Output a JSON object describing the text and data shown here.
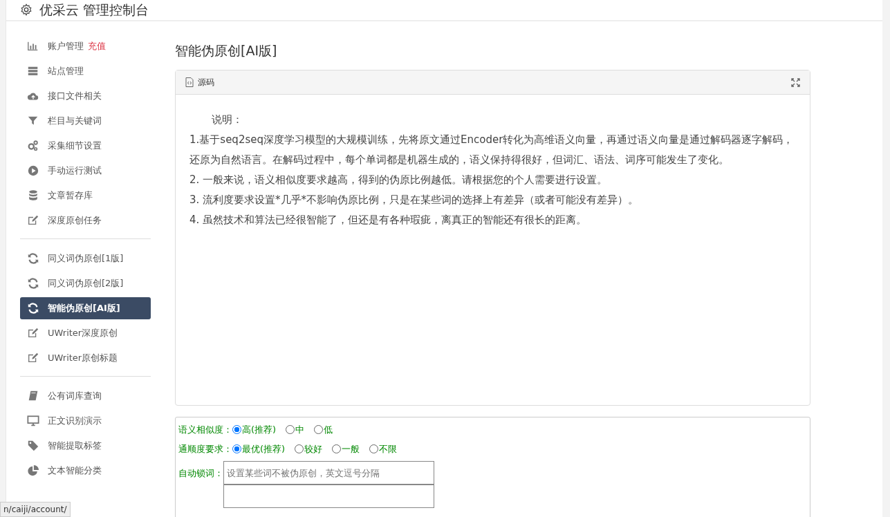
{
  "header": {
    "title": "优采云 管理控制台"
  },
  "sidebar": {
    "groups": [
      {
        "items": [
          {
            "label": "账户管理",
            "extra": "充值",
            "selected": false
          },
          {
            "label": "站点管理",
            "selected": false
          },
          {
            "label": "接口文件相关",
            "selected": false
          },
          {
            "label": "栏目与关键词",
            "selected": false
          },
          {
            "label": "采集细节设置",
            "selected": false
          },
          {
            "label": "手动运行测试",
            "selected": false
          },
          {
            "label": "文章暂存库",
            "selected": false
          },
          {
            "label": "深度原创任务",
            "selected": false
          }
        ]
      },
      {
        "items": [
          {
            "label": "同义词伪原创[1版]",
            "selected": false
          },
          {
            "label": "同义词伪原创[2版]",
            "selected": false
          },
          {
            "label": "智能伪原创[AI版]",
            "selected": true
          },
          {
            "label": "UWriter深度原创",
            "selected": false
          },
          {
            "label": "UWriter原创标题",
            "selected": false
          }
        ]
      },
      {
        "items": [
          {
            "label": "公有词库查询",
            "selected": false
          },
          {
            "label": "正文识别演示",
            "selected": false
          },
          {
            "label": "智能提取标签",
            "selected": false
          },
          {
            "label": "文本智能分类",
            "selected": false
          }
        ]
      }
    ]
  },
  "page_title": "智能伪原创[AI版]",
  "editor": {
    "tab": "源码",
    "lines": [
      "说明：",
      "1.基于seq2seq深度学习模型的大规模训练，先将原文通过Encoder转化为高维语义向量，再通过语义向量是通过解码器逐字解码，还原为自然语言。在解码过程中，每个单词都是机器生成的，语义保持得很好，但词汇、语法、词序可能发生了变化。",
      "2. 一般来说，语义相似度要求越高，得到的伪原比例越低。请根据您的个人需要进行设置。",
      "3. 流利度要求设置*几乎*不影响伪原比例，只是在某些词的选择上有差异（或者可能没有差异）。",
      "4. 虽然技术和算法已经很智能了，但还是有各种瑕疵，离真正的智能还有很长的距离。"
    ]
  },
  "options": {
    "radio_groups": [
      {
        "label": "语义相似度：",
        "options": [
          {
            "label": "高(推荐)",
            "selected": true
          },
          {
            "label": "中",
            "selected": false
          },
          {
            "label": "低",
            "selected": false
          }
        ]
      },
      {
        "label": "通顺度要求：",
        "options": [
          {
            "label": "最优(推荐)",
            "selected": true
          },
          {
            "label": "较好",
            "selected": false
          },
          {
            "label": "一般",
            "selected": false
          },
          {
            "label": "不限",
            "selected": false
          }
        ]
      }
    ],
    "lock_words": {
      "label": "自动锁词：",
      "placeholder": "设置某些词不被伪原创，英文逗号分隔"
    }
  },
  "status_url": "n/caiji/account/"
}
